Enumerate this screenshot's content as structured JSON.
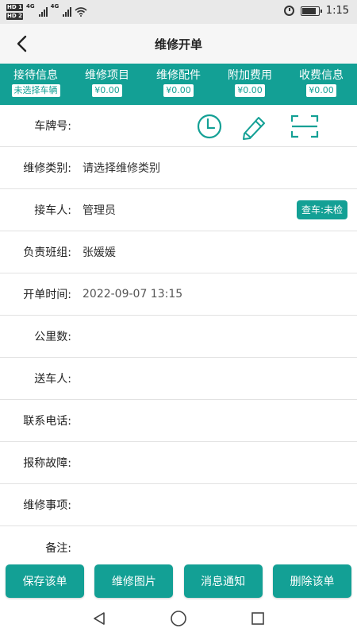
{
  "status_bar": {
    "sim1": "HD 1",
    "sim2": "HD 2",
    "net1": "4G",
    "net2": "4G",
    "time": "1:15",
    "battery_level": 0.85
  },
  "header": {
    "title": "维修开单"
  },
  "tabs": [
    {
      "label": "接待信息",
      "value": "未选择车辆"
    },
    {
      "label": "维修项目",
      "value": "¥0.00"
    },
    {
      "label": "维修配件",
      "value": "¥0.00"
    },
    {
      "label": "附加费用",
      "value": "¥0.00"
    },
    {
      "label": "收费信息",
      "value": "¥0.00"
    }
  ],
  "form": {
    "plate": {
      "label": "车牌号:"
    },
    "repair_type": {
      "label": "维修类别:",
      "value": "请选择维修类别"
    },
    "receiver": {
      "label": "接车人:",
      "value": "管理员",
      "badge": "查车:未检"
    },
    "team": {
      "label": "负责班组:",
      "value": "张媛媛"
    },
    "open_time": {
      "label": "开单时间:",
      "value": "2022-09-07 13:15"
    },
    "mileage": {
      "label": "公里数:"
    },
    "sender": {
      "label": "送车人:"
    },
    "phone": {
      "label": "联系电话:"
    },
    "fault": {
      "label": "报称故障:"
    },
    "matters": {
      "label": "维修事项:"
    },
    "remark": {
      "label": "备注:"
    }
  },
  "actions": {
    "save": "保存该单",
    "photos": "维修图片",
    "notify": "消息通知",
    "delete": "删除该单"
  },
  "colors": {
    "accent": "#13a095",
    "status_bar_bg": "#e9e9e9",
    "title_bar_bg": "#f6f6f6"
  }
}
